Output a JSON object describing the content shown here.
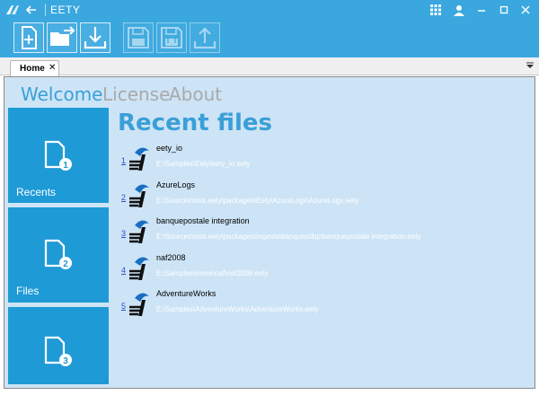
{
  "window": {
    "title": "EETY"
  },
  "toolbar": {
    "buttons": [
      {
        "icon": "new-file-icon",
        "enabled": true
      },
      {
        "icon": "open-folder-icon",
        "enabled": true
      },
      {
        "icon": "download-icon",
        "enabled": true
      },
      {
        "icon": "save-icon",
        "enabled": false
      },
      {
        "icon": "save-all-icon",
        "enabled": false
      },
      {
        "icon": "upload-icon",
        "enabled": false
      }
    ]
  },
  "tabs": [
    {
      "label": "Home",
      "close": "✕"
    }
  ],
  "nav": {
    "welcome": "Welcome",
    "license": "License",
    "about": "About"
  },
  "sidebar": {
    "items": [
      {
        "label": "Recents",
        "badge": "1"
      },
      {
        "label": "Files",
        "badge": "2"
      },
      {
        "label": "",
        "badge": "3"
      }
    ]
  },
  "recent": {
    "title": "Recent files",
    "files": [
      {
        "num": "1",
        "name": "eety_io",
        "path": "E:\\Samples\\Eety\\eety_io.eety"
      },
      {
        "num": "2",
        "name": "AzureLogs",
        "path": "E:\\Sources\\root.eety\\packages\\Eety\\AzureLogs\\AzureLogs.eety"
      },
      {
        "num": "3",
        "name": "banquepostale integration",
        "path": "E:\\Sources\\root.eety\\packages\\Ingexia\\banques\\lbp\\banquepostale integration.eety"
      },
      {
        "num": "4",
        "name": "naf2008",
        "path": "E:\\Samples\\Insee\\naf\\naf2008.eety"
      },
      {
        "num": "5",
        "name": "AdventureWorks",
        "path": "E:\\Samples\\AdventureWorks\\AdventureWorks.eety"
      }
    ]
  },
  "colors": {
    "accent": "#3aa8df",
    "tile": "#1e9ad6",
    "panel": "#cde4f6",
    "heading": "#3a9fd8"
  }
}
